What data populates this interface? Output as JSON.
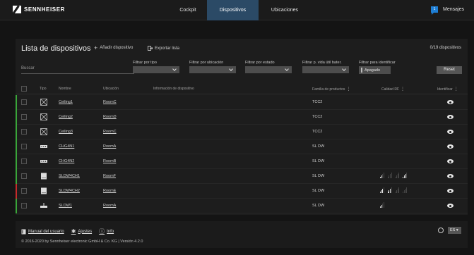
{
  "nav": {
    "brand": "SENNHEISER",
    "tabs": [
      {
        "label": "Cockpit"
      },
      {
        "label": "Dispositivos"
      },
      {
        "label": "Ubicaciones"
      }
    ],
    "messages_label": "Mensajes",
    "messages_count": "1"
  },
  "panel": {
    "title": "Lista de dispositivos",
    "add_device": "Añadir dispositivo",
    "export_list": "Exportar lista",
    "count": "0/19 dispositivos"
  },
  "filters": {
    "search_placeholder": "Buscar",
    "type_label": "Filtrar por tipo",
    "location_label": "Filtrar por ubicación",
    "status_label": "Filtrar por estado",
    "battery_label": "Filtrar p. vida útil bater.",
    "identify_label": "Filtrar para identificar",
    "identify_value": "Apagado",
    "reset_label": "Reset"
  },
  "table": {
    "headers": {
      "type": "Tipo",
      "name": "Nombre",
      "location": "Ubicación",
      "info": "Información de dispositivo",
      "family": "Familia de productos",
      "rf": "Calidad RF",
      "identify": "Identificar"
    },
    "rows": [
      {
        "icon": "ceiling-mic-icon",
        "name": "Ceiling1",
        "location": "RoomC",
        "family": "TCC2",
        "stripe": "#3aa63a",
        "rf": []
      },
      {
        "icon": "ceiling-mic-icon",
        "name": "Ceiling2",
        "location": "RoomD",
        "family": "TCC2",
        "stripe": "#3aa63a",
        "rf": []
      },
      {
        "icon": "ceiling-mic-icon",
        "name": "Ceiling3",
        "location": "RoomC",
        "family": "TCC2",
        "stripe": "#3aa63a",
        "rf": []
      },
      {
        "icon": "charger-icon",
        "name": "CHG4N1",
        "location": "RoomA",
        "family": "SL DW",
        "stripe": "#3aa63a",
        "rf": []
      },
      {
        "icon": "charger-icon",
        "name": "CHG4N2",
        "location": "RoomB",
        "family": "SL DW",
        "stripe": "#3aa63a",
        "rf": []
      },
      {
        "icon": "receiver-icon",
        "name": "SLDW4CH1",
        "location": "RoomF",
        "family": "SL DW",
        "stripe": "#3aa63a",
        "rf": [
          2,
          0,
          0,
          3
        ]
      },
      {
        "icon": "receiver-icon",
        "name": "SLDW4CH2",
        "location": "RoomE",
        "family": "SL DW",
        "stripe": "#c62b2b",
        "rf": [
          3,
          3,
          0,
          0
        ]
      },
      {
        "icon": "base-station-icon",
        "name": "SLDW1",
        "location": "RoomA",
        "family": "SL DW",
        "stripe": "#3aa63a",
        "rf": [
          2
        ]
      }
    ]
  },
  "footer": {
    "manual": "Manual del usuario",
    "settings": "Ajustes",
    "info": "Info",
    "copyright": "© 2016-2020 by Sennheiser electronic GmbH & Co. KG | Versión 4.2.0",
    "language": "ES"
  }
}
